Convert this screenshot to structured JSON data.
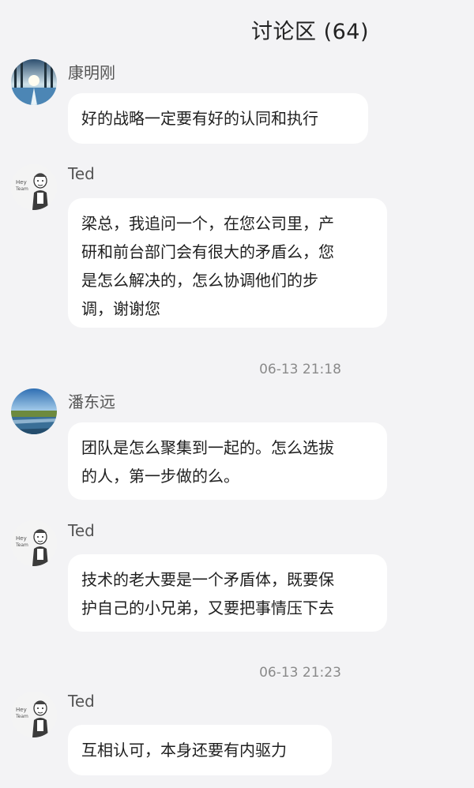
{
  "header": {
    "title": "讨论区 (64)"
  },
  "messages": [
    {
      "user": "康明刚",
      "avatar_icon": "winter-forest-avatar-icon",
      "lines": [
        "好的战略一定要有好的认同和执行"
      ]
    },
    {
      "user": "Ted",
      "avatar_icon": "ted-cartoon-avatar-icon",
      "lines": [
        "梁总，我追问一个，在您公司里，产",
        "研和前台部门会有很大的矛盾么，您",
        "是怎么解决的，怎么协调他们的步",
        "调，谢谢您"
      ]
    },
    {
      "user": "潘东远",
      "avatar_icon": "lake-landscape-avatar-icon",
      "lines": [
        "团队是怎么聚集到一起的。怎么选拔",
        "的人，第一步做的么。"
      ]
    },
    {
      "user": "Ted",
      "avatar_icon": "ted-cartoon-avatar-icon",
      "lines": [
        "技术的老大要是一个矛盾体，既要保",
        "护自己的小兄弟，又要把事情压下去"
      ]
    },
    {
      "user": "Ted",
      "avatar_icon": "ted-cartoon-avatar-icon",
      "lines": [
        "互相认可，本身还要有内驱力"
      ]
    }
  ],
  "timestamps": [
    "06-13 21:18",
    "06-13 21:23"
  ],
  "avatar_text": {
    "ted": [
      "Hey",
      "Team"
    ]
  },
  "colors": {
    "background": "#f3f3f5",
    "bubble": "#ffffff",
    "timestamp": "#8a8a8a",
    "username": "#555555"
  }
}
